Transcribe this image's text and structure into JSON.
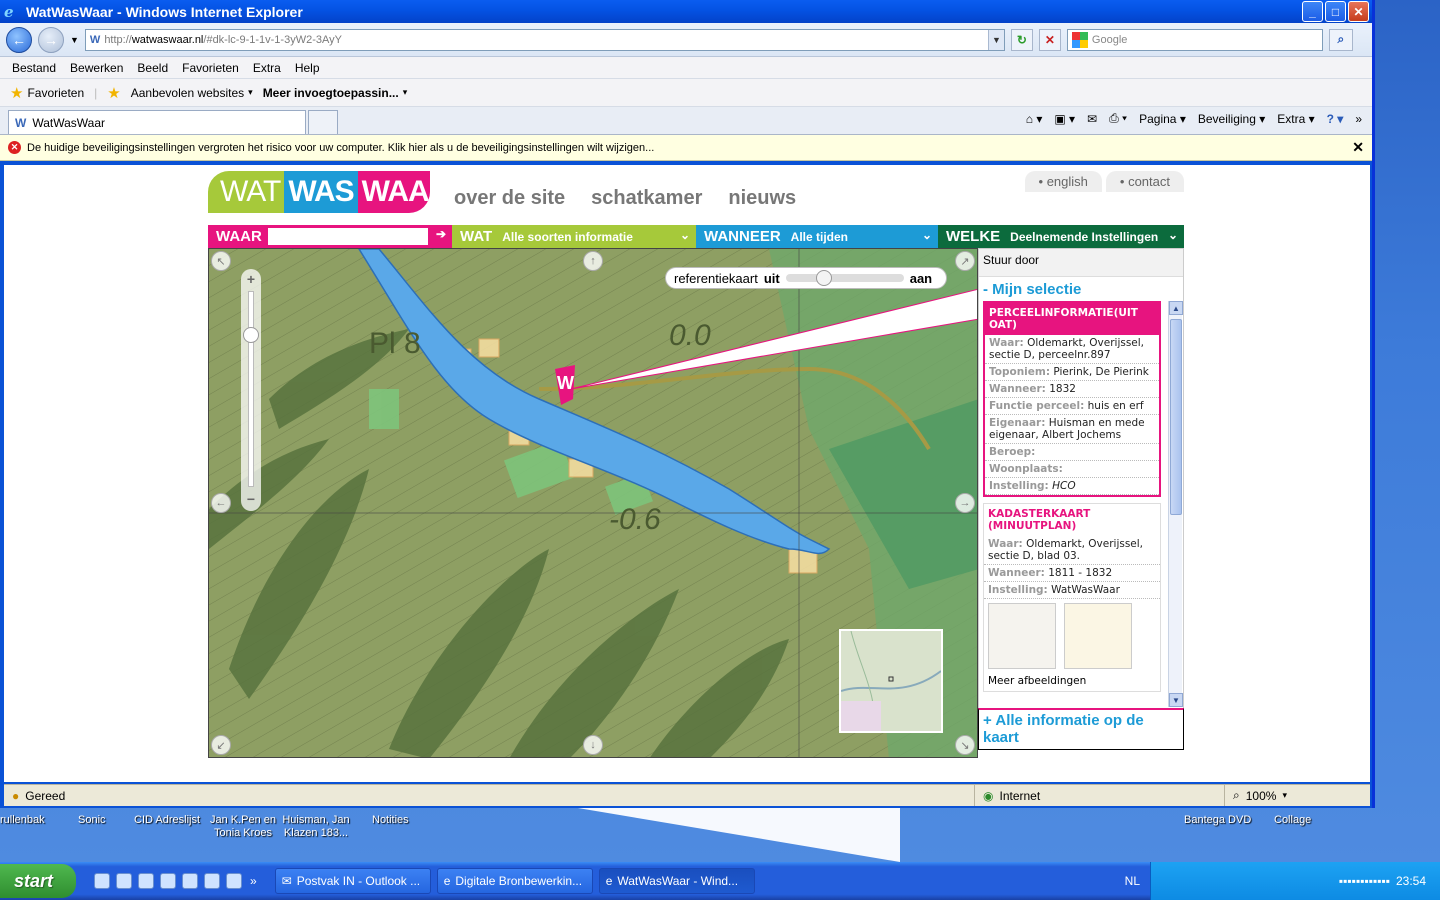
{
  "window": {
    "title": "WatWasWaar - Windows Internet Explorer"
  },
  "browser": {
    "url_prefix": "http://",
    "url_host": "watwaswaar.nl",
    "url_rest": "/#dk-lc-9-1-1v-1-3yW2-3AyY",
    "search_placeholder": "Google",
    "menu": [
      "Bestand",
      "Bewerken",
      "Beeld",
      "Favorieten",
      "Extra",
      "Help"
    ],
    "favorites_label": "Favorieten",
    "fav_item1": "Aanbevolen websites",
    "fav_item2": "Meer invoegtoepassin...",
    "tab_title": "WatWasWaar",
    "cmd": {
      "page": "Pagina",
      "security": "Beveiliging",
      "extra": "Extra"
    },
    "infobar": "De huidige beveiligingsinstellingen vergroten het risico voor uw computer. Klik hier als u de beveiligingsinstellingen wilt wijzigen...",
    "status_left": "Gereed",
    "status_zone": "Internet",
    "status_zoom": "100%"
  },
  "site": {
    "logo": {
      "a": "WAT",
      "b": "WAS",
      "c": "WAAR"
    },
    "nav": [
      "over de site",
      "schatkamer",
      "nieuws"
    ],
    "links": {
      "english": "english",
      "contact": "contact"
    },
    "filters": {
      "waar": "WAAR",
      "wat": "WAT",
      "wat_value": "Alle soorten informatie",
      "wanneer": "WANNEER",
      "wanneer_value": "Alle tijden",
      "welke": "WELKE",
      "welke_value": "Deelnemende Instellingen"
    },
    "map": {
      "ref_label": "referentiekaart",
      "ref_off": "uit",
      "ref_on": "aan",
      "labels": [
        "Pl 8",
        "0.0",
        "-0.6"
      ]
    },
    "sidebar": {
      "stuur": "Stuur door",
      "selection_title": "- Mijn selectie",
      "card1": {
        "title": "PERCEELINFORMATIE(UIT OAT)",
        "rows": [
          {
            "k": "Waar:",
            "v": "Oldemarkt, Overijssel, sectie D, perceelnr.897"
          },
          {
            "k": "Toponiem:",
            "v": "Pierink, De Pierink"
          },
          {
            "k": "Wanneer:",
            "v": "1832"
          },
          {
            "k": "Functie perceel:",
            "v": "huis en erf"
          },
          {
            "k": "Eigenaar:",
            "v": "Huisman en mede eigenaar, Albert Jochems"
          },
          {
            "k": "Beroep:",
            "v": ""
          },
          {
            "k": "Woonplaats:",
            "v": ""
          },
          {
            "k": "Instelling:",
            "v": "HCO"
          }
        ]
      },
      "card2": {
        "title": "KADASTERKAART (MINUUTPLAN)",
        "rows": [
          {
            "k": "Waar:",
            "v": "Oldemarkt, Overijssel, sectie D, blad 03."
          },
          {
            "k": "Wanneer:",
            "v": "1811 - 1832"
          },
          {
            "k": "Instelling:",
            "v": "WatWasWaar"
          }
        ],
        "more": "Meer afbeeldingen"
      },
      "all_info": "+ Alle informatie op de kaart"
    }
  },
  "desktop": {
    "icons": [
      "rullenbak",
      "Sonic",
      "CID Adreslijst",
      "Jan K.Pen en Tonia Kroes",
      "Huisman, Jan Klazen 183...",
      "Notities",
      "Bantega DVD",
      "Collage"
    ]
  },
  "taskbar": {
    "start": "start",
    "tasks": [
      "Postvak IN - Outlook ...",
      "Digitale Bronbewerkin...",
      "WatWasWaar - Wind..."
    ],
    "lang": "NL",
    "clock": "23:54"
  },
  "colors": {
    "pink": "#e7147f",
    "green": "#a6c93a",
    "blue": "#1d9bd6",
    "dark_green": "#0c6b3d"
  }
}
